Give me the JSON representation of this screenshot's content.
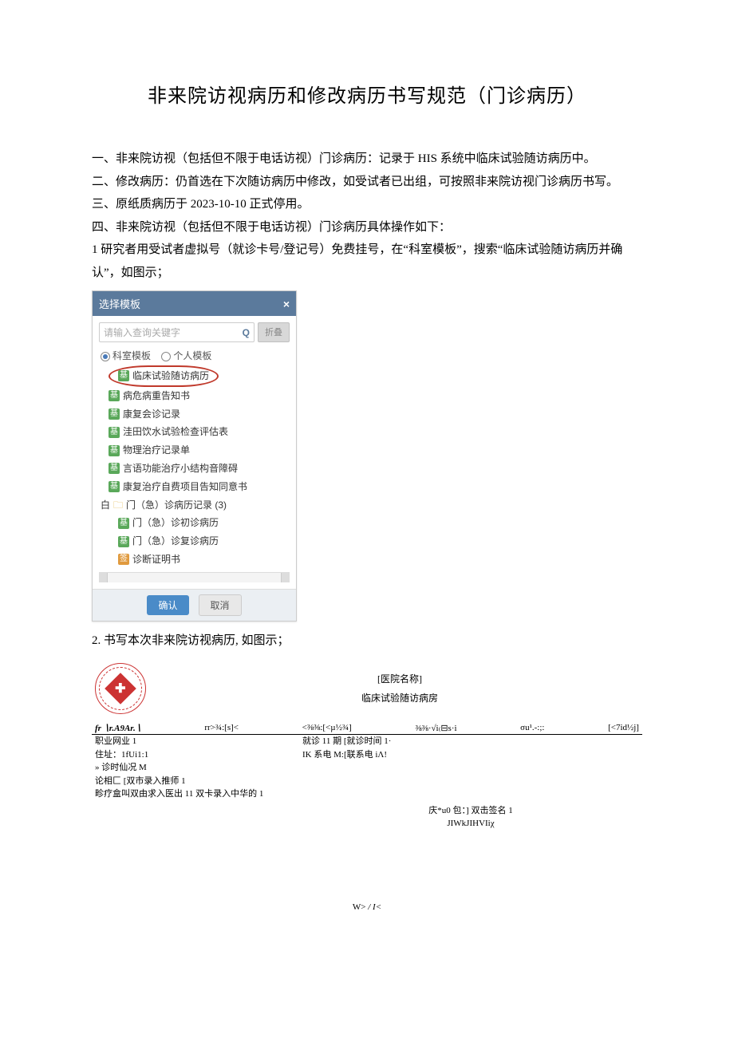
{
  "title": "非来院访视病历和修改病历书写规范（门诊病历）",
  "paras": {
    "p1": "一、非来院访视（包括但不限于电话访视）门诊病历：记录于 HIS 系统中临床试验随访病历中。",
    "p2": "二、修改病历：仍首选在下次随访病历中修改，如受试者已出组，可按照非来院访视门诊病历书写。",
    "p3": "三、原纸质病历于 2023-10-10 正式停用。",
    "p4": "四、非来院访视（包括但不限于电话访视）门诊病历具体操作如下：",
    "p5": "1 研究者用受试者虚拟号（就诊卡号/登记号）免费挂号，在“科室模板”，搜索“临床试验随访病历并确认”，如图示；",
    "p6": "2. 书写本次非来院访视病历, 如图示；"
  },
  "modal": {
    "title": "选择模板",
    "close": "×",
    "search_placeholder": "请输入查询关键字",
    "search_btn": "折叠",
    "tab_dept": "科室模板",
    "tab_personal": "个人模板",
    "tree": {
      "t1": "临床试验随访病历",
      "t2": "病危病重告知书",
      "t3": "康复会诊记录",
      "t4": "洼田饮水试验检查评估表",
      "t5": "物理治疗记录单",
      "t6": "言语功能治疗小结构音障碍",
      "t7": "康复治疗自费项目告知同意书",
      "folder": "门（急）诊病历记录 (3)",
      "t8": "门（急）诊初诊病历",
      "t9": "门（急）诊复诊病历",
      "t10": "诊断证明书"
    },
    "confirm": "确认",
    "cancel": "取消",
    "tag": "基",
    "tag2": "签",
    "folder_prefix": "白"
  },
  "form": {
    "hospital_name": "[医院名称]",
    "ward_title": "临床试验随访病房",
    "row1": {
      "c1": "fr ∖r.A9Ar.∖",
      "c2": "rr>¾:[s]<",
      "c3": "<⅜⅜:[<µ½¾]",
      "c4": "⅜⅜·√i₍⊟s·i",
      "c5": "σu¹.-:;:",
      "c6": "[<7id½j]"
    },
    "l1": "职业网业 1",
    "l1b": "就诊 11 期 [就诊时间 1·",
    "l2": "住址：1fUi1:1",
    "l2b": "IK 系电 M:[联系电 iΛ!",
    "l3": "» 诊时仙况 M",
    "l4": "论相匚 [双市录入推师 1",
    "l5": "畛疗盒叫双由求入医出 11 双卡录入中华的 1",
    "sig1": "庆*u0 包：] 双击签名 1",
    "sig2": "JIWkJIHVIiχ"
  },
  "footer": {
    "left": "W>",
    "mid": " / ",
    "right": "I<"
  }
}
